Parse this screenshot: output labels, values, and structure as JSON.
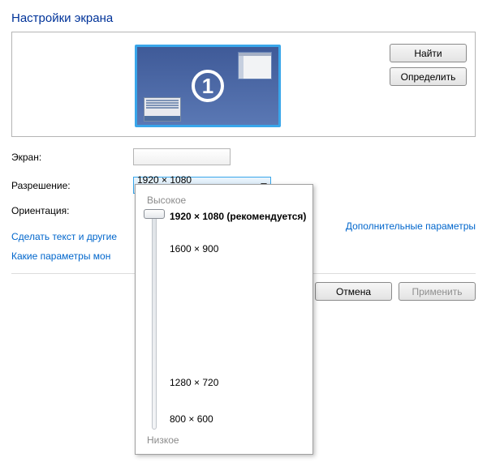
{
  "title": "Настройки экрана",
  "monitor_number": "1",
  "buttons": {
    "find": "Найти",
    "identify": "Определить",
    "cancel": "Отмена",
    "apply": "Применить"
  },
  "labels": {
    "screen": "Экран:",
    "resolution": "Разрешение:",
    "orientation": "Ориентация:"
  },
  "resolution_selected": "1920 × 1080 (рекомендуется)",
  "links": {
    "text_size": "Сделать текст и другие",
    "which_params": "Какие параметры мон",
    "additional": "Дополнительные параметры"
  },
  "popup": {
    "high": "Высокое",
    "low": "Низкое",
    "options": [
      {
        "label": "1920 × 1080 (рекомендуется)",
        "pos": 0,
        "selected": true
      },
      {
        "label": "1600 × 900",
        "pos": 40,
        "selected": false
      },
      {
        "label": "1280 × 720",
        "pos": 205,
        "selected": false
      },
      {
        "label": "800 × 600",
        "pos": 250,
        "selected": false
      }
    ]
  }
}
